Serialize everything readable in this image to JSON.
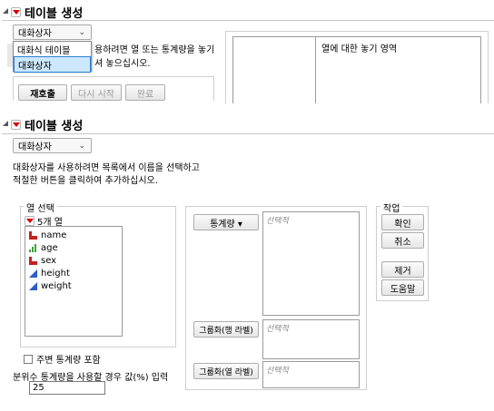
{
  "top": {
    "panel_title": "테이블 생성",
    "combo_value": "대화상자",
    "dropdown_options": [
      "대화식 테이블",
      "대화상자"
    ],
    "hint_partial_1": "용하려면 열 또는 통계량을 놓기",
    "hint_partial_2": "셔 놓으십시오.",
    "buttons": {
      "undo": "재호출",
      "restart": "다시 시작",
      "done": "완료"
    },
    "drop_zone_label": "열에 대한 놓기 영역"
  },
  "bottom": {
    "panel_title": "테이블 생성",
    "combo_value": "대화상자",
    "description_line1": "대화상자를 사용하려면 목록에서 이름을 선택하고",
    "description_line2": "적절한 버튼을 클릭하여 추가하십시오.",
    "column_select_label": "열 선택",
    "column_count": "5개 열",
    "columns": [
      {
        "name": "name",
        "icon": "nominal-icon"
      },
      {
        "name": "age",
        "icon": "ordinal-icon"
      },
      {
        "name": "sex",
        "icon": "nominal-icon"
      },
      {
        "name": "height",
        "icon": "continuous-icon"
      },
      {
        "name": "weight",
        "icon": "continuous-icon"
      }
    ],
    "roles": {
      "statistics_button": "통계량 ▾",
      "statistics_placeholder": "선택적",
      "group_row_button": "그룹화(행 라벨)",
      "group_row_placeholder": "선택적",
      "group_col_button": "그룹화(열 라벨)",
      "group_col_placeholder": "선택적"
    },
    "action_label": "작업",
    "actions": {
      "ok": "확인",
      "cancel": "취소",
      "remove": "제거",
      "help": "도움말"
    },
    "marginal_checkbox_label": "주변 통계량 포함",
    "quantile_label": "분위수 통계량을 사용할 경우 값(%) 입력",
    "quantile_value": "25"
  },
  "colors": {
    "red_triangle": "#d40000",
    "selection": "#cce8ff",
    "selection_border": "#2b7fd4"
  }
}
